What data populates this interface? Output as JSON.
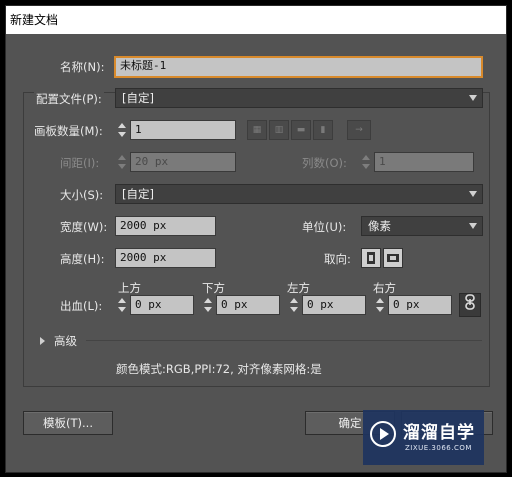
{
  "title": "新建文档",
  "name_label": "名称(N):",
  "name_value": "未标题-1",
  "profile_label": "配置文件(P):",
  "profile_value": "[自定]",
  "artboards_label": "画板数量(M):",
  "artboards_value": "1",
  "spacing_label": "间距(I):",
  "spacing_value": "20 px",
  "columns_label": "列数(O):",
  "columns_value": "1",
  "size_label": "大小(S):",
  "size_value": "[自定]",
  "width_label": "宽度(W):",
  "width_value": "2000 px",
  "units_label": "单位(U):",
  "units_value": "像素",
  "height_label": "高度(H):",
  "height_value": "2000 px",
  "orientation_label": "取向:",
  "bleed_label": "出血(L):",
  "bleed_top_label": "上方",
  "bleed_top_value": "0 px",
  "bleed_bottom_label": "下方",
  "bleed_bottom_value": "0 px",
  "bleed_left_label": "左方",
  "bleed_left_value": "0 px",
  "bleed_right_label": "右方",
  "bleed_right_value": "0 px",
  "advanced_label": "高级",
  "color_info": "颜色模式:RGB,PPI:72, 对齐像素网格:是",
  "templates_button": "模板(T)...",
  "ok_button": "确定",
  "watermark_brand": "溜溜自学",
  "watermark_url": "ZIXUE.3066.COM",
  "colors": {
    "dialog_bg": "#535353",
    "focus_border": "#d88a2c",
    "watermark_bg": "#1e3460"
  }
}
